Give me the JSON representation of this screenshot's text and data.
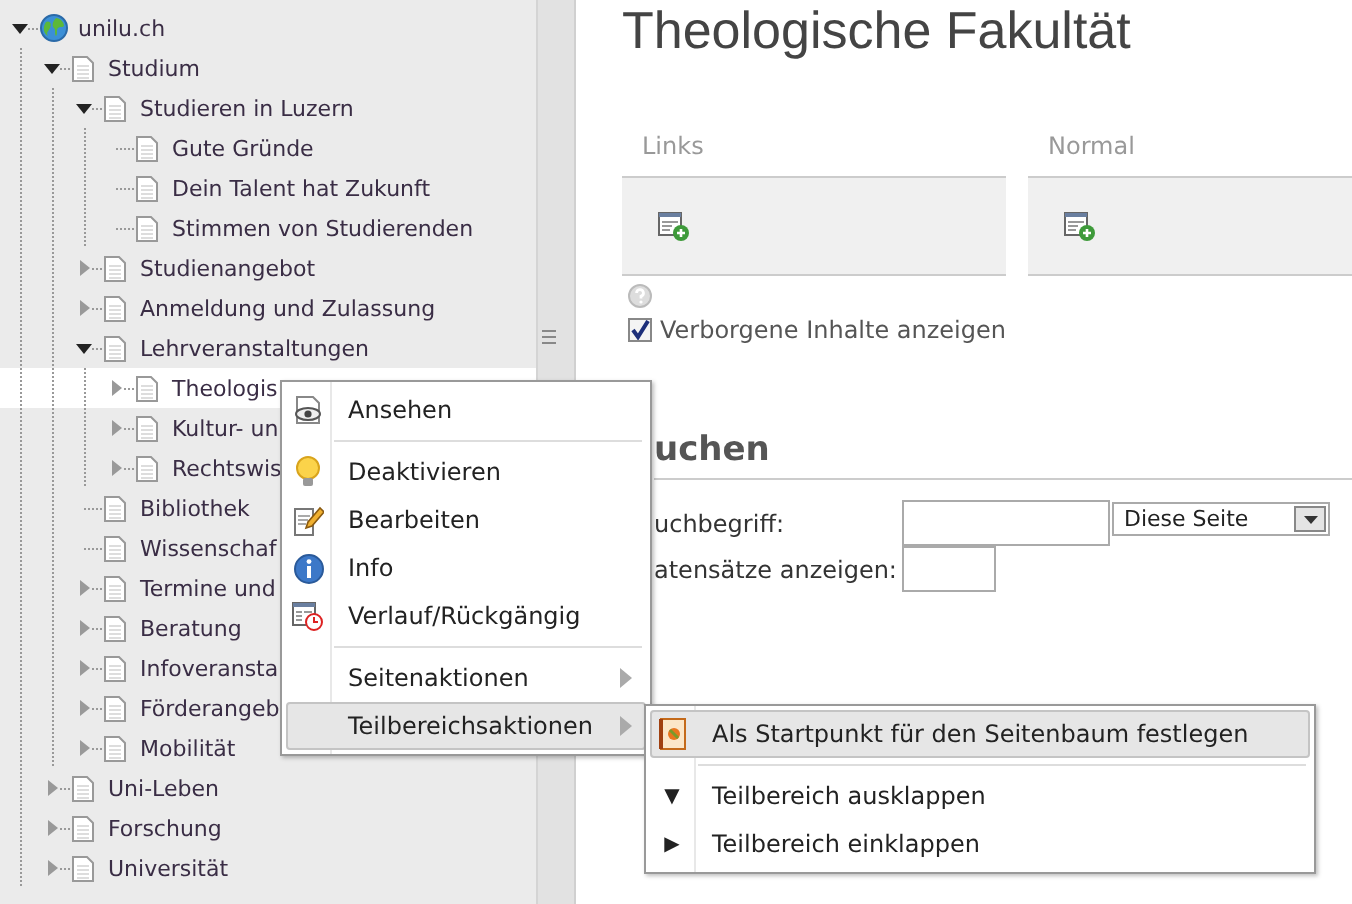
{
  "tree": [
    {
      "label": "unilu.ch",
      "expandable": true,
      "expanded": true,
      "selected": false,
      "children": [
        {
          "label": "Studium",
          "expandable": true,
          "expanded": true,
          "selected": false,
          "children": [
            {
              "label": "Studieren in Luzern",
              "expandable": true,
              "expanded": true,
              "selected": false,
              "children": [
                {
                  "label": "Gute Gründe",
                  "expandable": false,
                  "selected": false
                },
                {
                  "label": "Dein Talent hat Zukunft",
                  "expandable": false,
                  "selected": false
                },
                {
                  "label": "Stimmen von Studierenden",
                  "expandable": false,
                  "selected": false
                }
              ]
            },
            {
              "label": "Studienangebot",
              "expandable": true,
              "expanded": false,
              "selected": false
            },
            {
              "label": "Anmeldung und Zulassung",
              "expandable": true,
              "expanded": false,
              "selected": false
            },
            {
              "label": "Lehrveranstaltungen",
              "expandable": true,
              "expanded": true,
              "selected": false,
              "children": [
                {
                  "label": "Theologis",
                  "expandable": true,
                  "expanded": false,
                  "selected": true
                },
                {
                  "label": "Kultur- un",
                  "expandable": true,
                  "expanded": false,
                  "selected": false
                },
                {
                  "label": "Rechtswis",
                  "expandable": true,
                  "expanded": false,
                  "selected": false
                }
              ]
            },
            {
              "label": "Bibliothek",
              "expandable": false,
              "selected": false
            },
            {
              "label": "Wissenschaf",
              "expandable": false,
              "selected": false
            },
            {
              "label": "Termine und",
              "expandable": true,
              "expanded": false,
              "selected": false
            },
            {
              "label": "Beratung",
              "expandable": true,
              "expanded": false,
              "selected": false
            },
            {
              "label": "Infoveransta",
              "expandable": true,
              "expanded": false,
              "selected": false
            },
            {
              "label": "Förderangeb",
              "expandable": true,
              "expanded": false,
              "selected": false
            },
            {
              "label": "Mobilität",
              "expandable": true,
              "expanded": false,
              "selected": false
            }
          ]
        },
        {
          "label": "Uni-Leben",
          "expandable": true,
          "expanded": false,
          "selected": false
        },
        {
          "label": "Forschung",
          "expandable": true,
          "expanded": false,
          "selected": false
        },
        {
          "label": "Universität",
          "expandable": true,
          "expanded": false,
          "selected": false
        }
      ]
    }
  ],
  "content": {
    "title": "Theologische Fakultät",
    "columns": [
      {
        "label": "Links"
      },
      {
        "label": "Normal"
      }
    ],
    "show_hidden": {
      "label": "Verborgene Inhalte anzeigen",
      "checked": true
    },
    "search": {
      "heading": "uchen",
      "term_label": "uchbegriff:",
      "scope": "Diese Seite",
      "records_label": "atensätze anzeigen:"
    }
  },
  "context_menu": {
    "items": [
      {
        "kind": "item",
        "label": "Ansehen",
        "selected": false,
        "has_submenu": false
      },
      {
        "kind": "separator"
      },
      {
        "kind": "item",
        "label": "Deaktivieren",
        "selected": false,
        "has_submenu": false
      },
      {
        "kind": "item",
        "label": "Bearbeiten",
        "selected": false,
        "has_submenu": false
      },
      {
        "kind": "item",
        "label": "Info",
        "selected": false,
        "has_submenu": false
      },
      {
        "kind": "item",
        "label": "Verlauf/Rückgängig",
        "selected": false,
        "has_submenu": false
      },
      {
        "kind": "separator"
      },
      {
        "kind": "item",
        "label": "Seitenaktionen",
        "selected": false,
        "has_submenu": true
      },
      {
        "kind": "item",
        "label": "Teilbereichsaktionen",
        "selected": true,
        "has_submenu": true
      }
    ]
  },
  "submenu": {
    "items": [
      {
        "kind": "item",
        "label": "Als Startpunkt für den Seitenbaum festlegen",
        "selected": true,
        "has_submenu": false
      },
      {
        "kind": "separator"
      },
      {
        "kind": "item",
        "label": "Teilbereich ausklappen",
        "marker": "▼",
        "selected": false,
        "has_submenu": false
      },
      {
        "kind": "item",
        "label": "Teilbereich einklappen",
        "marker": "▶",
        "selected": false,
        "has_submenu": false
      }
    ]
  }
}
